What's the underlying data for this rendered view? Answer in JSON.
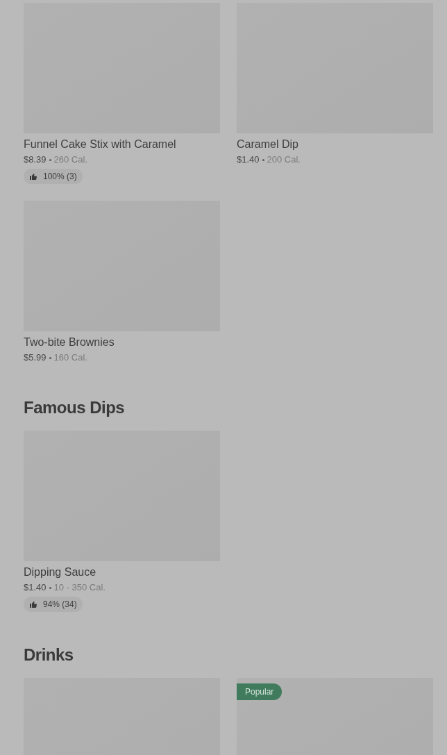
{
  "sections": [
    {
      "items": [
        {
          "kind": "item",
          "name": "Funnel Cake Stix with Caramel",
          "price": "$8.39",
          "calories": "260 Cal.",
          "rating": "100% (3)"
        },
        {
          "kind": "item",
          "name": "Caramel Dip",
          "price": "$1.40",
          "calories": "200 Cal."
        },
        {
          "kind": "item",
          "name": "Two-bite Brownies",
          "price": "$5.99",
          "calories": "160 Cal."
        }
      ]
    },
    {
      "heading": "Famous Dips",
      "items": [
        {
          "kind": "item",
          "name": "Dipping Sauce",
          "price": "$1.40",
          "calories": "10 - 350 Cal.",
          "rating": "94% (34)"
        }
      ]
    },
    {
      "heading": "Drinks",
      "items": [
        {
          "kind": "photo-only"
        },
        {
          "kind": "photo-only",
          "badge": "Popular"
        }
      ]
    }
  ]
}
